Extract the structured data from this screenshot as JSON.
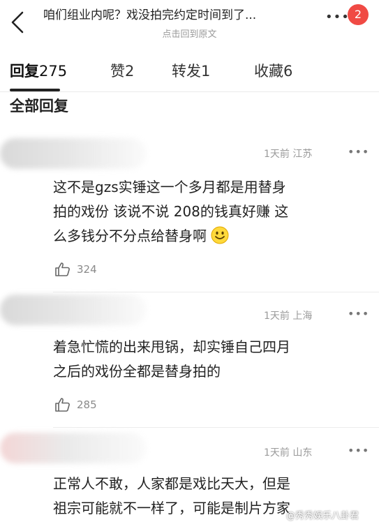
{
  "header": {
    "title": "咱们组业内呢？戏没拍完约定时间到了...",
    "subtitle": "点击回到原文",
    "more": "•••",
    "badge": "2"
  },
  "tabs": [
    {
      "label": "回复",
      "count": "275"
    },
    {
      "label": "赞",
      "count": "2"
    },
    {
      "label": "转发",
      "count": "1"
    },
    {
      "label": "收藏",
      "count": "6"
    }
  ],
  "section_title": "全部回复",
  "comments": [
    {
      "meta": "1天前 江苏",
      "more": "•••",
      "lines": [
        "这不是gzs实锤这一个多月都是用替身",
        "拍的戏份 该说不说 208的钱真好赚 这",
        "么多钱分不分点给替身啊"
      ],
      "likes": "324"
    },
    {
      "meta": "1天前 上海",
      "more": "•••",
      "lines": [
        "着急忙慌的出来甩锅，却实锤自己四月",
        "之后的戏份全都是替身拍的"
      ],
      "likes": "285"
    },
    {
      "meta": "1天前 山东",
      "more": "•••",
      "lines": [
        "正常人不敢，人家都是戏比天大，但是",
        "祖宗可能就不一样了，可能是制片方家"
      ],
      "likes": ""
    }
  ],
  "watermark": "@秀秀娱乐八卦君",
  "colors": {
    "badge": "#f04a44",
    "meta": "#9a9a9a"
  }
}
